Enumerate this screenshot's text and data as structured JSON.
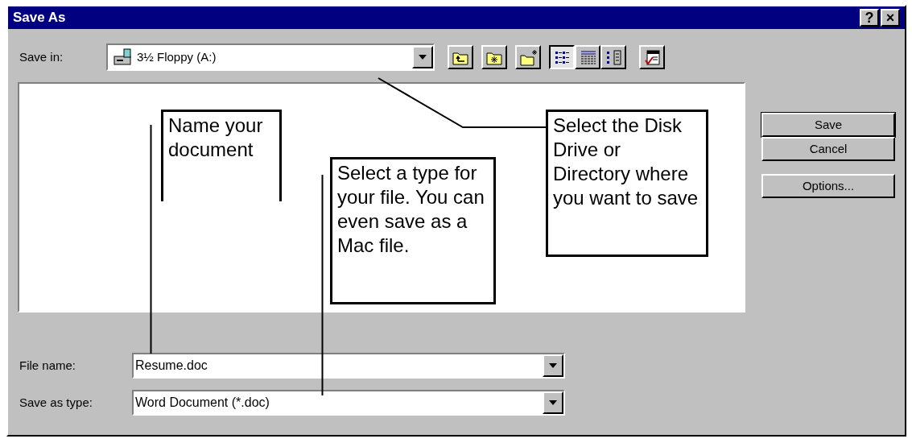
{
  "window": {
    "title": "Save As",
    "title_buttons": [
      "?",
      "×"
    ]
  },
  "save_in": {
    "label": "Save in:",
    "value": "3½ Floppy (A:)"
  },
  "toolbar": [
    {
      "kind": "up-folder",
      "selected": false
    },
    {
      "kind": "desktop",
      "selected": false
    },
    {
      "kind": "new-folder",
      "selected": false
    },
    {
      "kind": "list",
      "selected": true
    },
    {
      "kind": "details",
      "selected": false
    },
    {
      "kind": "properties",
      "selected": false
    },
    {
      "kind": "commands",
      "selected": false
    }
  ],
  "buttons": [
    "Save",
    "Cancel",
    "Options..."
  ],
  "file_name": {
    "label": "File name:",
    "value": "Resume.doc"
  },
  "save_as_type": {
    "label": "Save as type:",
    "value": "Word Document (*.doc)"
  },
  "callouts": [
    {
      "kind": "name",
      "text": "Name your document"
    },
    {
      "kind": "type",
      "text": "Select a type for your file. You can even save as a Mac file."
    },
    {
      "kind": "drive",
      "text": "Select the Disk Drive or Directory where you want to save"
    }
  ]
}
